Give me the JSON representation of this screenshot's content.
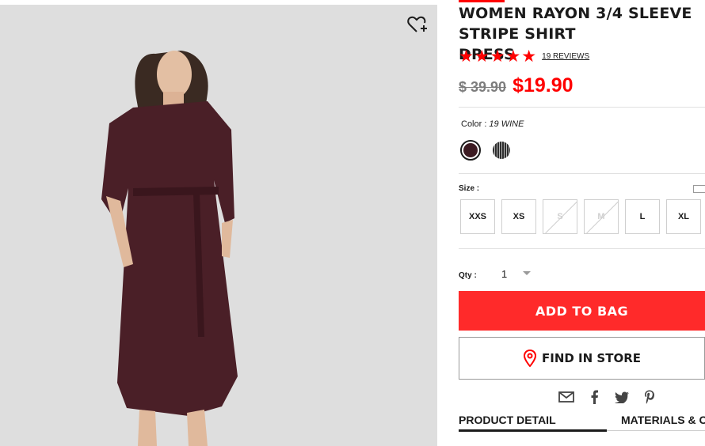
{
  "product": {
    "title": "WOMEN RAYON 3/4 SLEEVE STRIPE SHIRT\nDRESS",
    "rating_stars": "★★★★★",
    "reviews_label": "19 REVIEWS",
    "original_price": "$ 39.90",
    "sale_price": "$19.90"
  },
  "color": {
    "label": "Color :",
    "selected": "19 WINE",
    "swatches": [
      {
        "name": "wine",
        "hex": "#3c1b22"
      },
      {
        "name": "navy-stripe",
        "hex": "#2e2e2e"
      }
    ]
  },
  "size": {
    "label": "Size :",
    "options": [
      {
        "label": "XXS",
        "available": true
      },
      {
        "label": "XS",
        "available": true
      },
      {
        "label": "S",
        "available": false
      },
      {
        "label": "M",
        "available": false
      },
      {
        "label": "L",
        "available": true
      },
      {
        "label": "XL",
        "available": true
      }
    ]
  },
  "quantity": {
    "label": "Qty :",
    "value": "1"
  },
  "actions": {
    "add_to_bag": "ADD TO BAG",
    "find_in_store": "FIND IN STORE"
  },
  "share_icons": [
    "mail-icon",
    "facebook-icon",
    "twitter-icon",
    "pinterest-icon"
  ],
  "tabs": [
    {
      "label": "PRODUCT DETAIL"
    },
    {
      "label": "MATERIALS & CARE"
    }
  ],
  "colors": {
    "accent_red": "#ff0000",
    "button_red": "#ff2a2a",
    "text": "#1b1b1b",
    "muted": "#7d7d7d"
  }
}
